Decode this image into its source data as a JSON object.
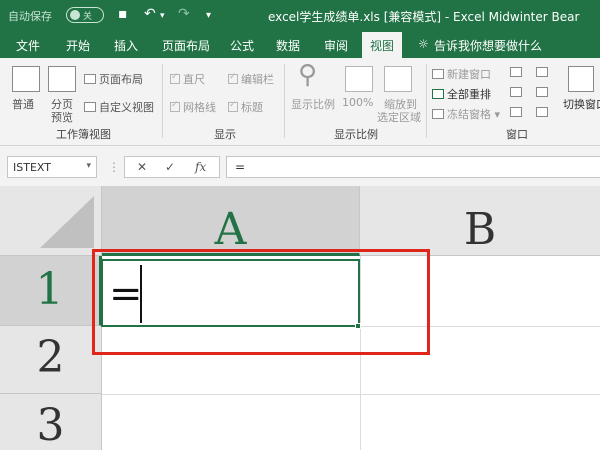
{
  "titlebar": {
    "autosave_label": "自动保存",
    "autosave_state": "关",
    "title": "excel学生成绩单.xls  [兼容模式]  -  Excel    Midwinter Bear"
  },
  "menu": [
    "文件",
    "开始",
    "插入",
    "页面布局",
    "公式",
    "数据",
    "审阅",
    "视图"
  ],
  "tell_me": "告诉我你想要做什么",
  "ribbon": {
    "workbook_views": {
      "label": "工作簿视图",
      "normal": "普通",
      "page_break_1": "分页",
      "page_break_2": "预览",
      "page_layout": "页面布局",
      "custom_views": "自定义视图"
    },
    "show": {
      "label": "显示",
      "ruler": "直尺",
      "formula_bar": "编辑栏",
      "gridlines": "网格线",
      "headings": "标题"
    },
    "zoom": {
      "label": "显示比例",
      "zoom": "显示比例",
      "zoom_100": "100%",
      "zoom_sel_1": "缩放到",
      "zoom_sel_2": "选定区域"
    },
    "window": {
      "label": "窗口",
      "new_window": "新建窗口",
      "arrange_all": "全部重排",
      "freeze_panes": "冻结窗格",
      "switch_windows": "切换窗口"
    }
  },
  "formula_bar": {
    "name_box": "ISTEXT",
    "cancel": "✕",
    "enter": "✓",
    "fx": "fx",
    "value": "="
  },
  "grid": {
    "columns": [
      "A",
      "B"
    ],
    "rows": [
      "1",
      "2",
      "3"
    ],
    "active_cell_value": "="
  },
  "colors": {
    "accent": "#217346",
    "highlight": "#e0251b"
  }
}
